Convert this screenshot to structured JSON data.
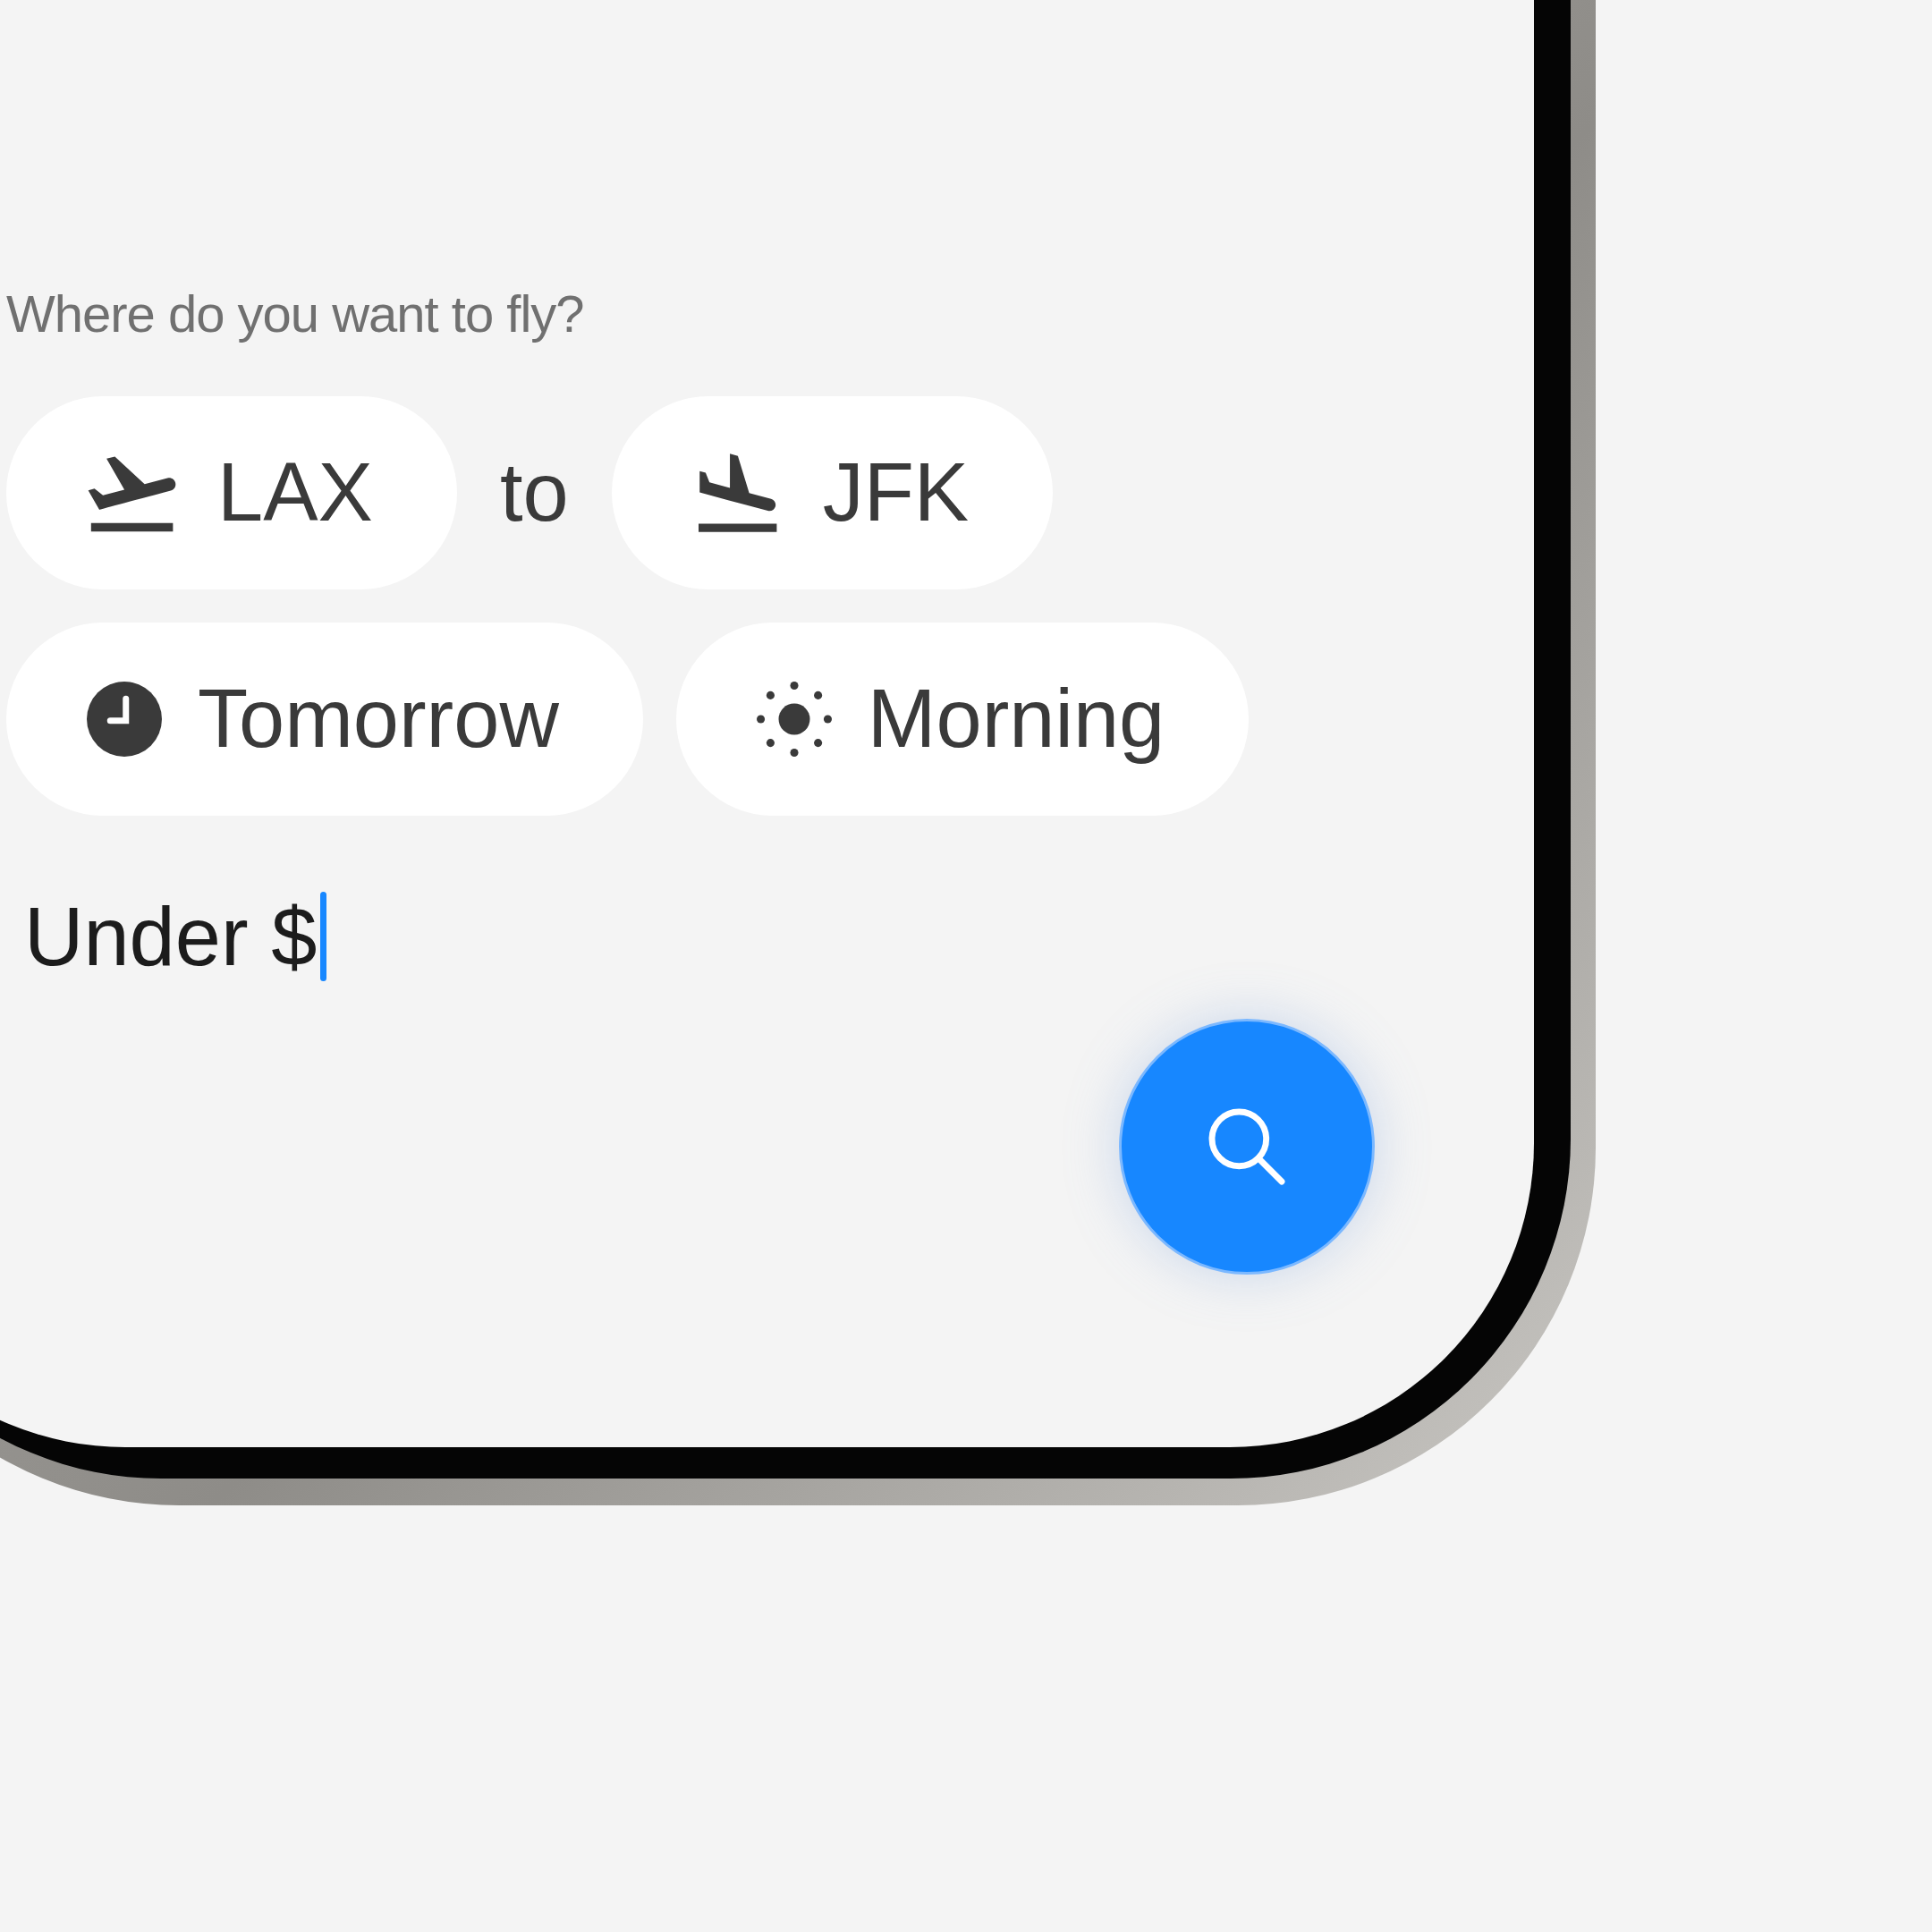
{
  "prompt": "Where do you want to fly?",
  "route": {
    "origin": {
      "kind": "takeoff",
      "code": "LAX"
    },
    "connector": "to",
    "destination": {
      "kind": "landing",
      "code": "JFK"
    }
  },
  "when": [
    {
      "kind": "date",
      "label": "Tomorrow"
    },
    {
      "kind": "time_of_day",
      "label": "Morning"
    }
  ],
  "budget_field": {
    "value": "Under $"
  }
}
